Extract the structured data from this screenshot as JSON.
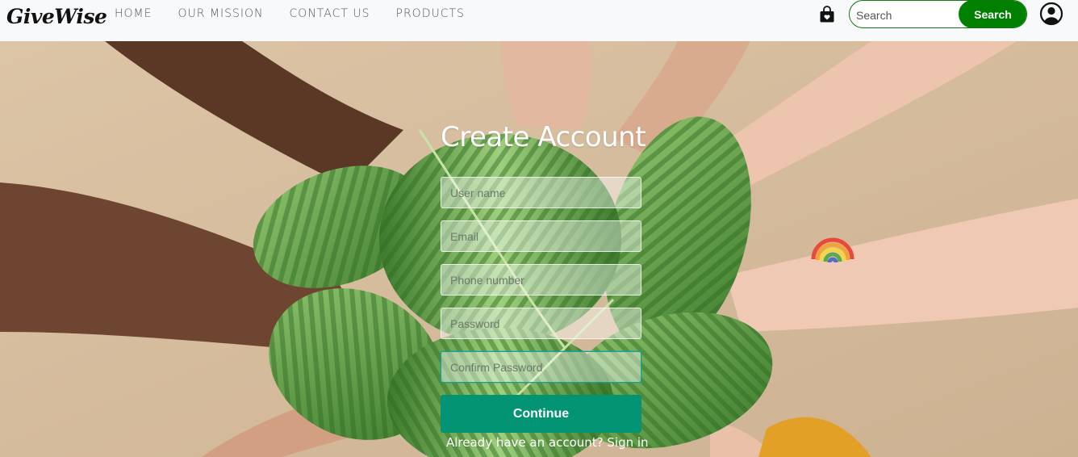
{
  "navbar": {
    "brand": "GiveWise",
    "links": [
      "HOME",
      "OUR MISSION",
      "CONTACT US",
      "PRODUCTS"
    ],
    "search_placeholder": "Search",
    "search_button": "Search",
    "icons": {
      "cart": "shopping-bag-icon",
      "account": "user-circle-icon"
    }
  },
  "form": {
    "title": "Create Account",
    "fields": [
      {
        "name": "username",
        "placeholder": "User name",
        "value": ""
      },
      {
        "name": "email",
        "placeholder": "Email",
        "value": ""
      },
      {
        "name": "phone",
        "placeholder": "Phone number",
        "value": ""
      },
      {
        "name": "password",
        "placeholder": "Password",
        "value": ""
      },
      {
        "name": "confirm_password",
        "placeholder": "Confirm Password",
        "value": ""
      }
    ],
    "continue_label": "Continue",
    "signin_prompt": "Already have an account?",
    "signin_link": "Sign in"
  },
  "colors": {
    "accent_green": "#008000",
    "continue_button": "#039474",
    "navbar_bg": "#f8f9fa"
  }
}
